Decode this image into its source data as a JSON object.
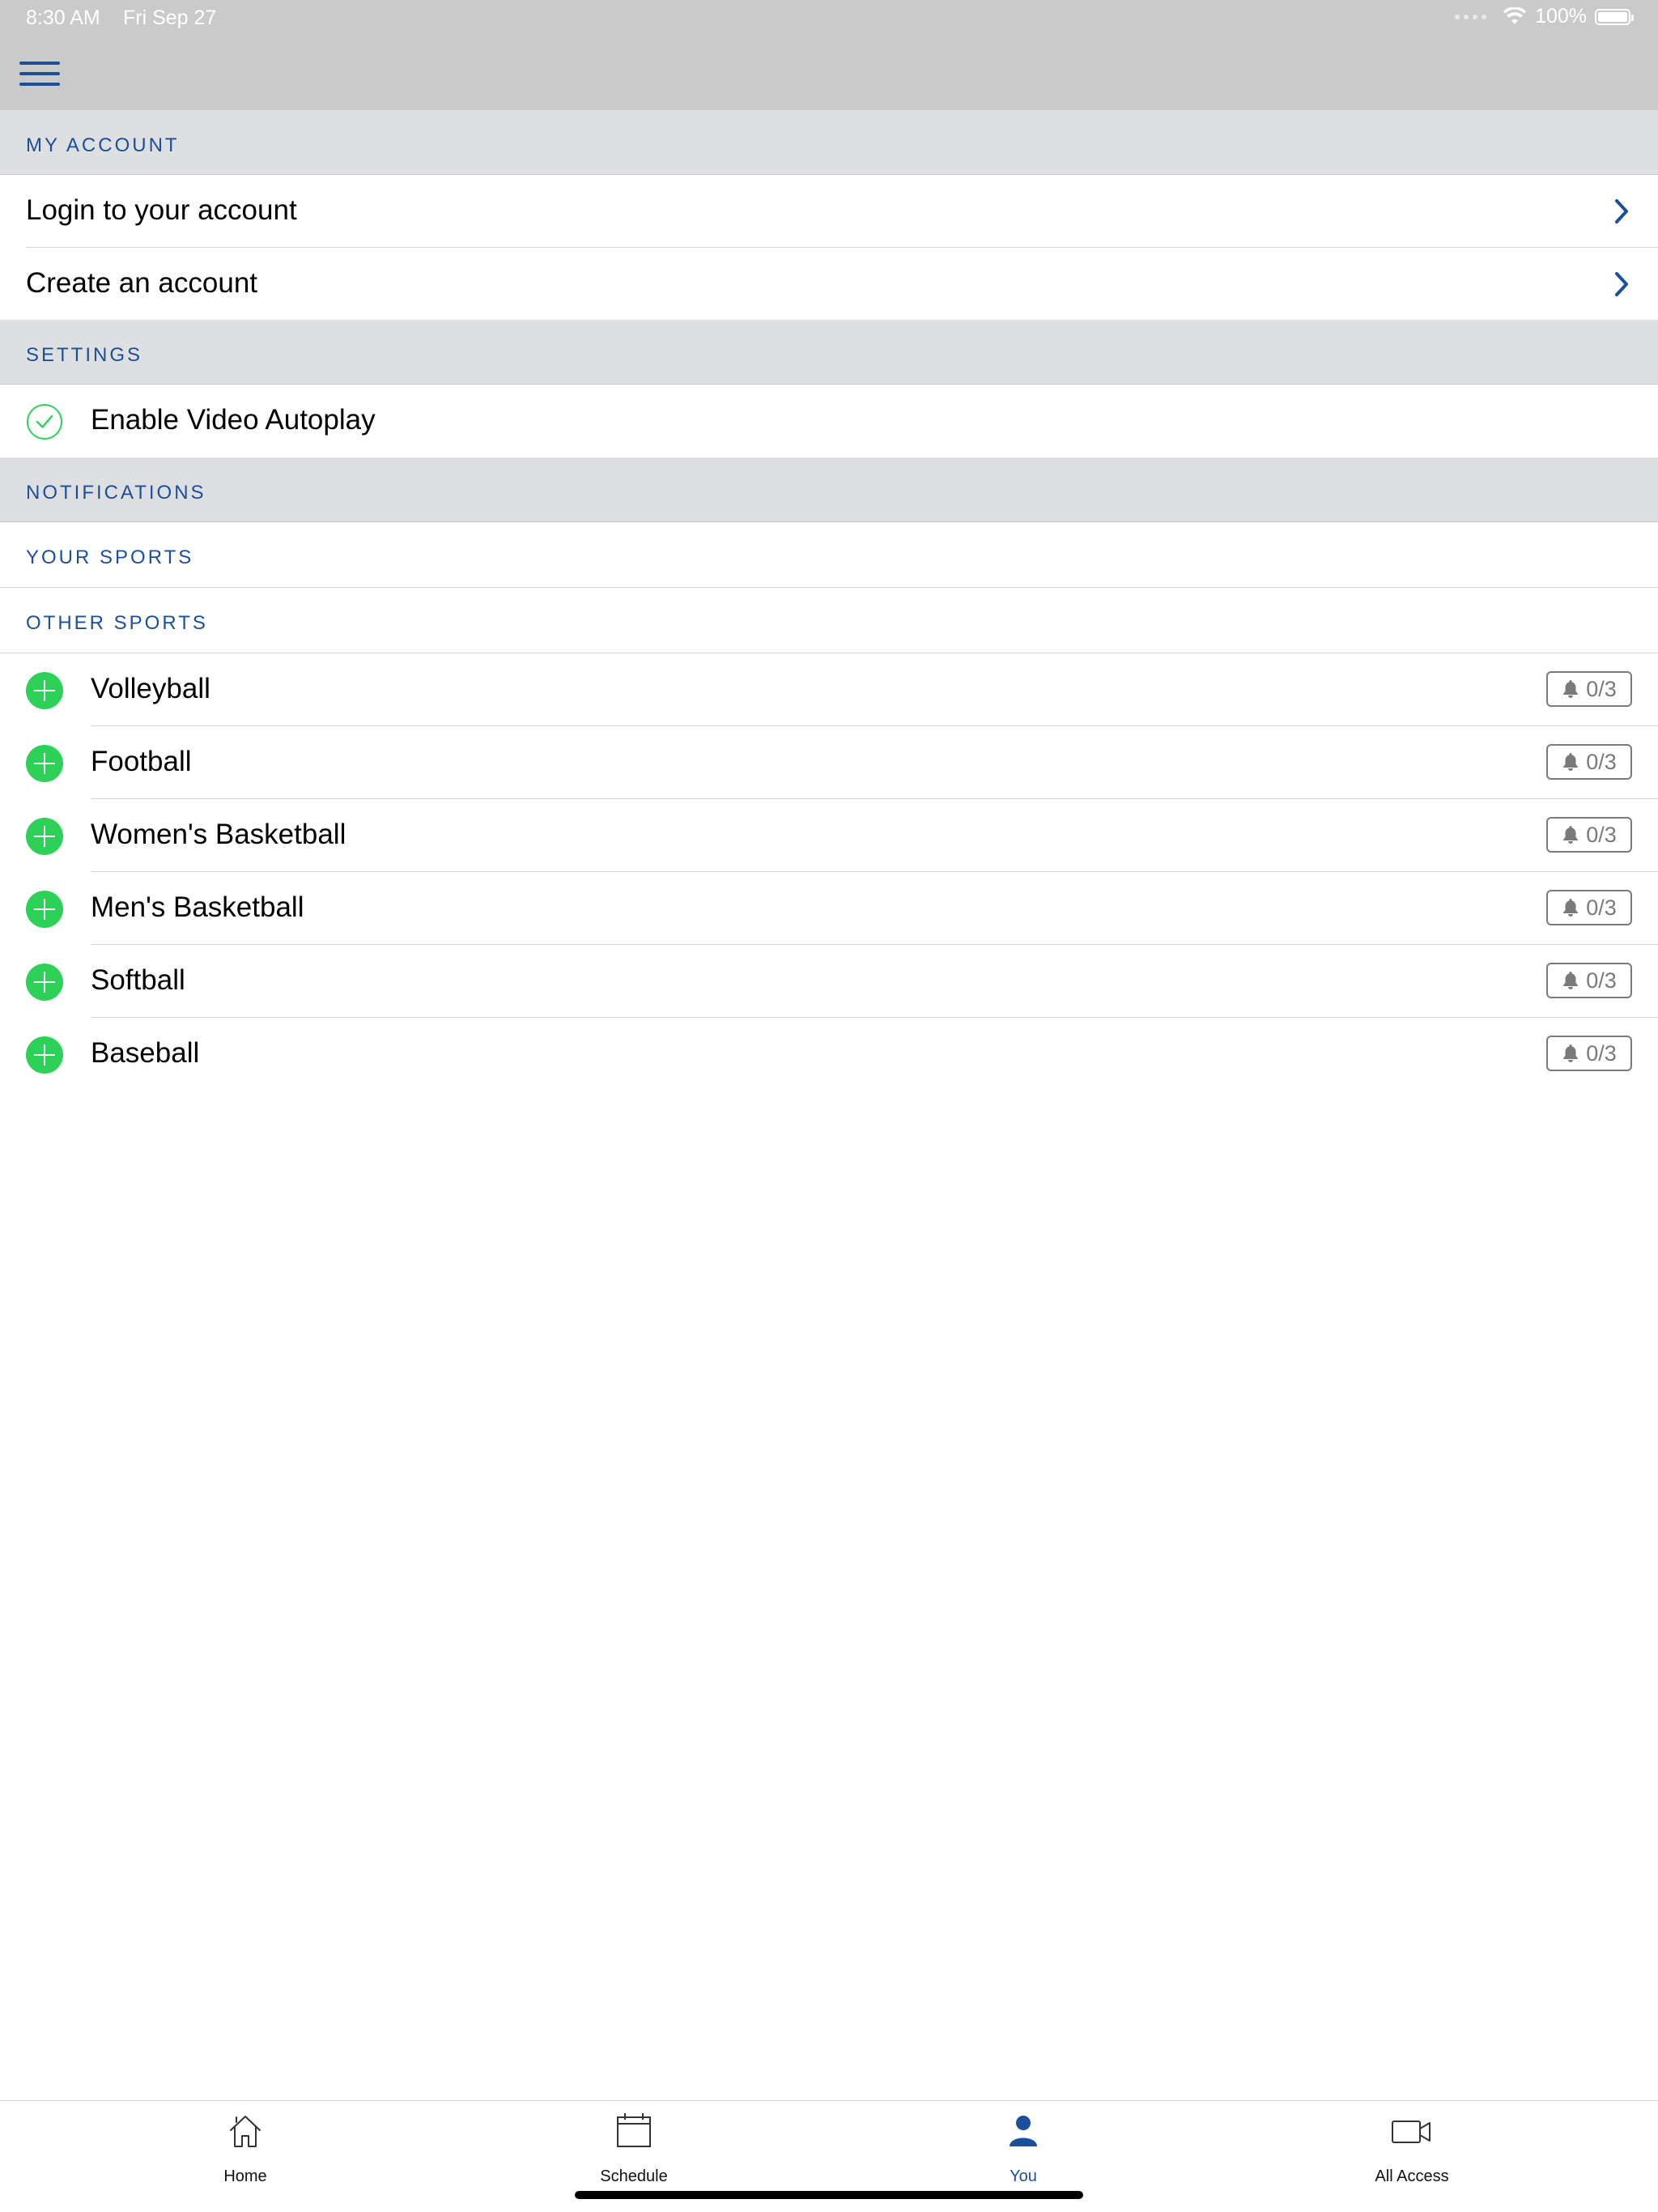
{
  "status_bar": {
    "time": "8:30 AM",
    "date": "Fri Sep 27",
    "battery": "100%"
  },
  "nav": {
    "menu_icon": "hamburger-menu-icon"
  },
  "sections": {
    "my_account": "MY ACCOUNT",
    "settings": "SETTINGS",
    "notifications": "NOTIFICATIONS",
    "your_sports": "YOUR SPORTS",
    "other_sports": "OTHER SPORTS"
  },
  "account_rows": [
    {
      "label": "Login to your account"
    },
    {
      "label": "Create an account"
    }
  ],
  "settings_rows": [
    {
      "label": "Enable Video Autoplay",
      "checked": true
    }
  ],
  "sports": [
    {
      "name": "Volleyball",
      "alerts": "0/3"
    },
    {
      "name": "Football",
      "alerts": "0/3"
    },
    {
      "name": "Women's Basketball",
      "alerts": "0/3"
    },
    {
      "name": "Men's Basketball",
      "alerts": "0/3"
    },
    {
      "name": "Softball",
      "alerts": "0/3"
    },
    {
      "name": "Baseball",
      "alerts": "0/3"
    }
  ],
  "tabs": [
    {
      "label": "Home",
      "icon": "home-icon"
    },
    {
      "label": "Schedule",
      "icon": "calendar-icon"
    },
    {
      "label": "You",
      "icon": "person-icon",
      "active": true
    },
    {
      "label": "All Access",
      "icon": "video-camera-icon"
    }
  ],
  "colors": {
    "accent": "#1b4f9c",
    "add_green": "#2dd158",
    "header_gray": "#cacaca",
    "section_gray": "#dedfe0"
  }
}
